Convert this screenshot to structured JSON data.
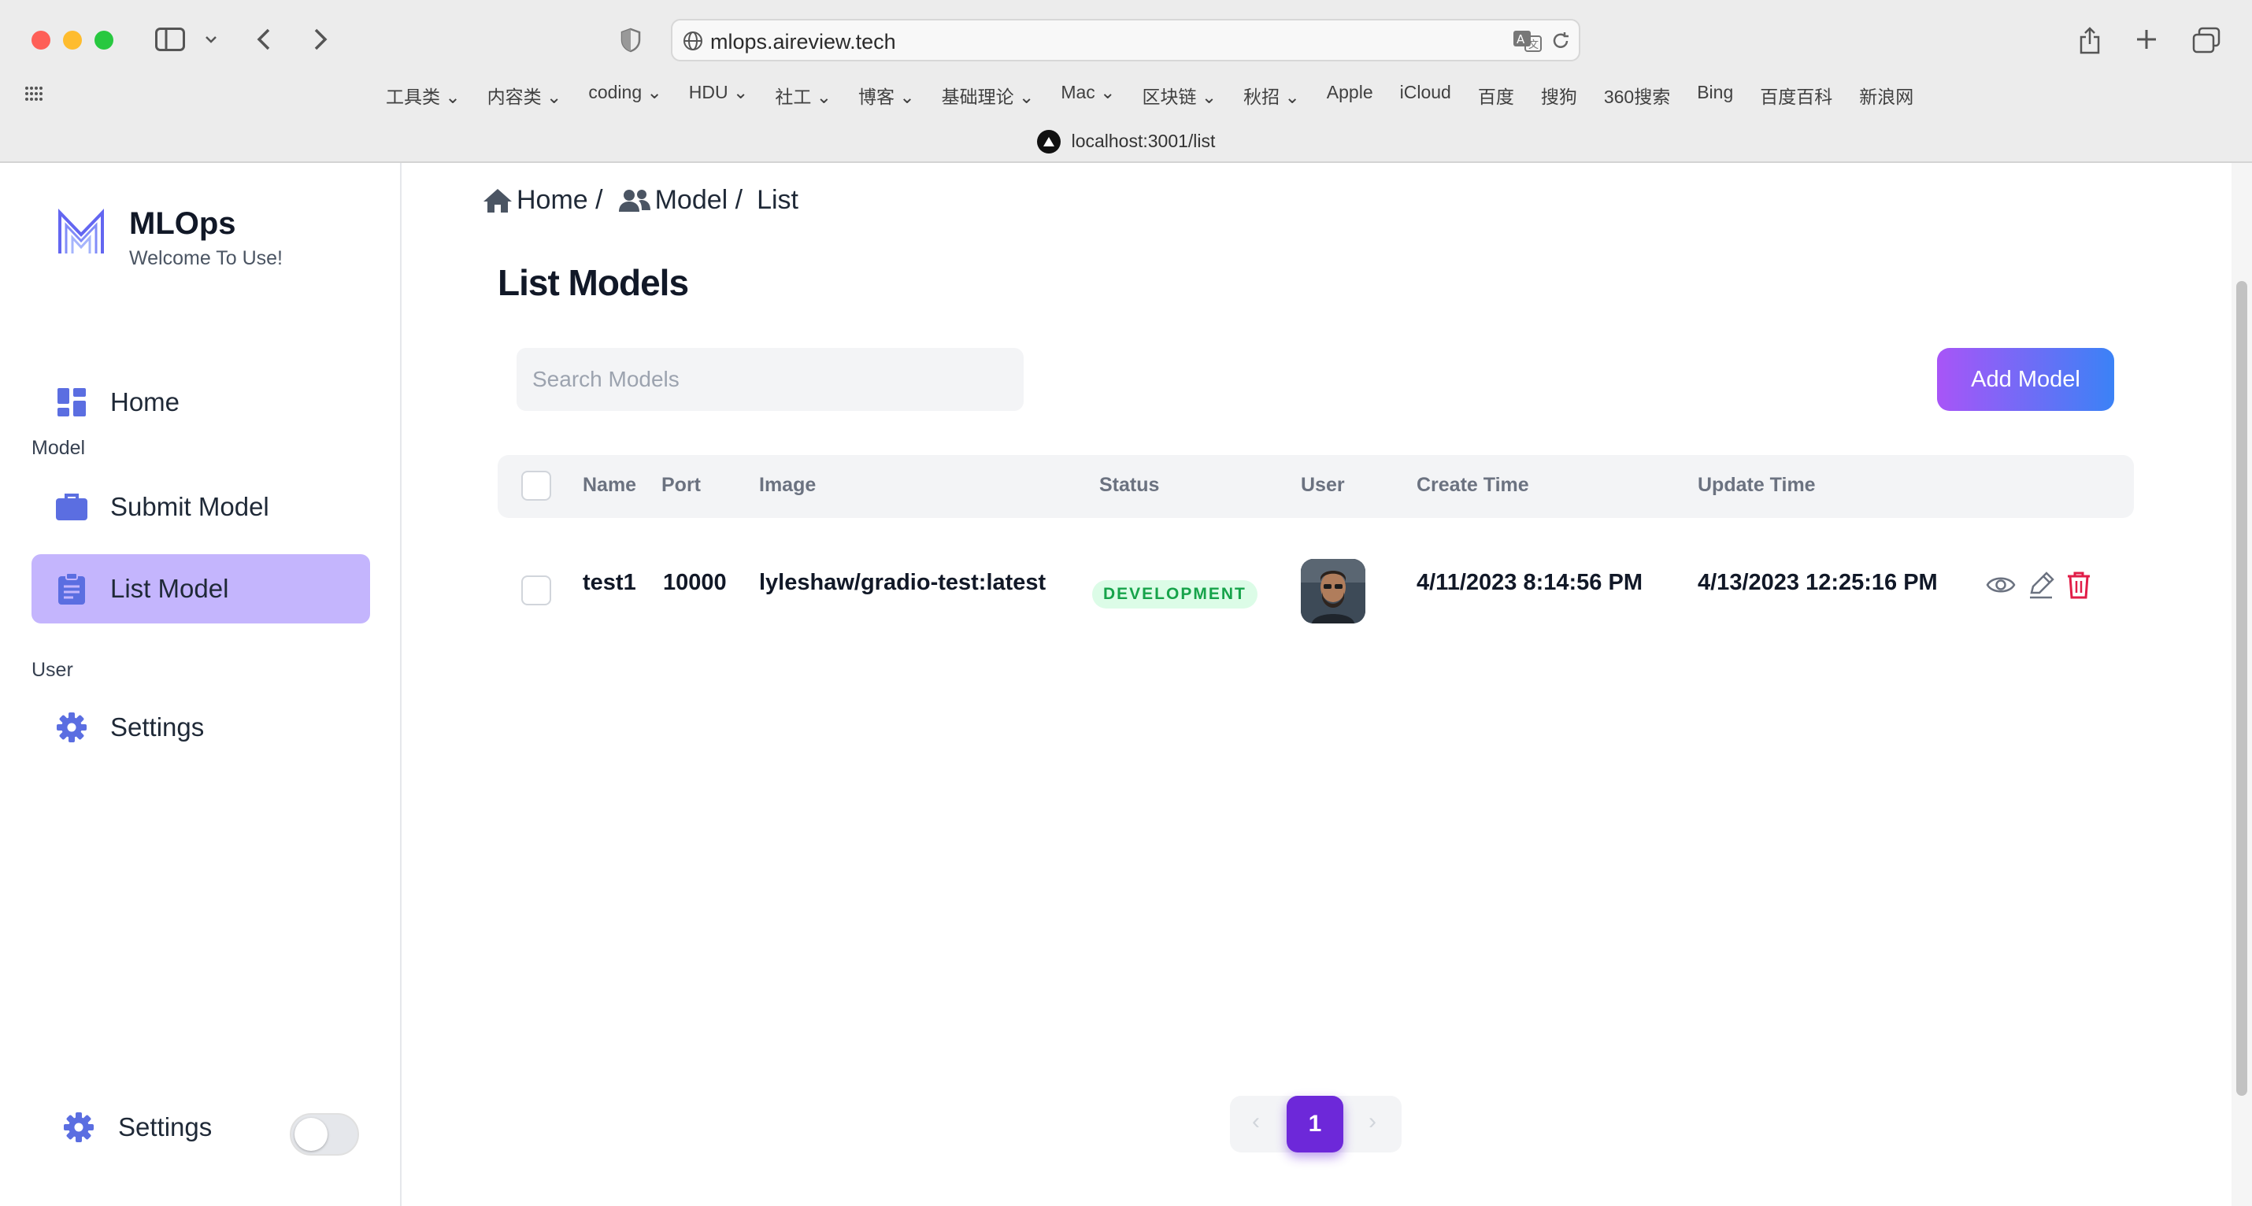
{
  "browser": {
    "url": "mlops.aireview.tech",
    "tab_url": "localhost:3001/list",
    "bookmarks": [
      "工具类",
      "内容类",
      "coding",
      "HDU",
      "社工",
      "博客",
      "基础理论",
      "Mac",
      "区块链",
      "秋招",
      "Apple",
      "iCloud",
      "百度",
      "搜狗",
      "360搜索",
      "Bing",
      "百度百科",
      "新浪网"
    ]
  },
  "sidebar": {
    "brand_name": "MLOps",
    "brand_subtitle": "Welcome To Use!",
    "home_label": "Home",
    "section_model": "Model",
    "submit_model_label": "Submit Model",
    "list_model_label": "List Model",
    "section_user": "User",
    "settings_label": "Settings",
    "footer_settings_label": "Settings",
    "accent_color": "#c4b5fd"
  },
  "breadcrumb": {
    "home": "Home /",
    "model": "Model /",
    "list": "List"
  },
  "main": {
    "title": "List Models",
    "search_placeholder": "Search Models",
    "add_button": "Add Model"
  },
  "table": {
    "headers": {
      "name": "Name",
      "port": "Port",
      "image": "Image",
      "status": "Status",
      "user": "User",
      "create_time": "Create Time",
      "update_time": "Update Time"
    },
    "rows": [
      {
        "name": "test1",
        "port": "10000",
        "image": "lyleshaw/gradio-test:latest",
        "status": "DEVELOPMENT",
        "create_time": "4/11/2023 8:14:56 PM",
        "update_time": "4/13/2023 12:25:16 PM"
      }
    ]
  },
  "pagination": {
    "current_page": "1",
    "prev": "‹",
    "next": "›"
  }
}
